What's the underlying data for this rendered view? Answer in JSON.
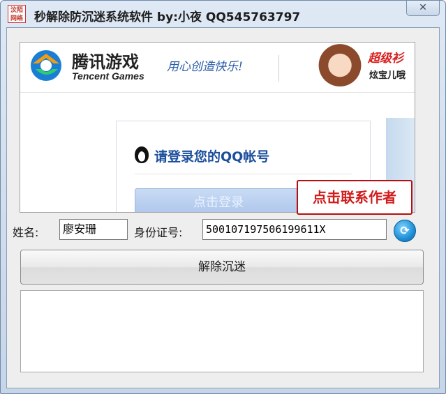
{
  "window": {
    "title": "秒解除防沉迷系统软件  by:小夜    QQ545763797",
    "icon_text": "汶陌网络",
    "close_label": "✕"
  },
  "banner": {
    "brand_cn": "腾讯游戏",
    "brand_en": "Tencent Games",
    "slogan": "用心创造快乐!",
    "promo_line1": "超级衫",
    "promo_line2": "炫宝儿哦"
  },
  "login": {
    "title": "请登录您的QQ帐号",
    "button_label": "点击登录"
  },
  "contact": {
    "label": "点击联系作者"
  },
  "form": {
    "name_label": "姓名:",
    "name_value": "廖安珊",
    "id_label": "身份证号:",
    "id_value": "500107197506199611X"
  },
  "actions": {
    "unlock_label": "解除沉迷",
    "refresh_icon": "⟳"
  },
  "log": {
    "text": ""
  },
  "colors": {
    "contact_text": "#d21b1b",
    "login_title": "#1b4f9c",
    "title_bar": "#dfe9f5"
  }
}
